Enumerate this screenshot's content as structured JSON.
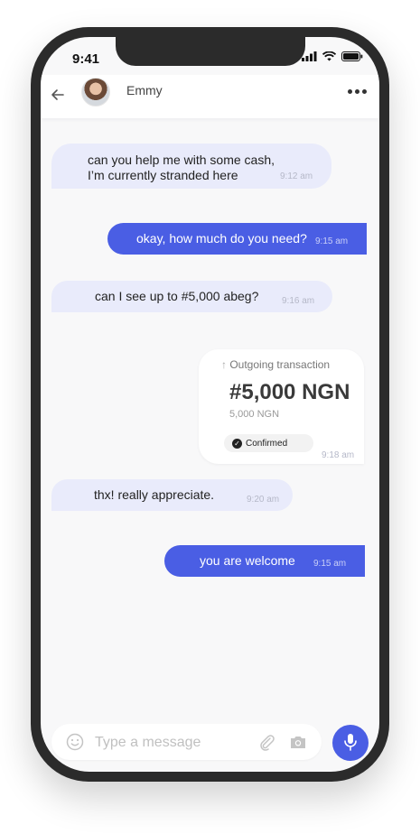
{
  "status_bar": {
    "time": "9:41"
  },
  "header": {
    "contact_name": "Emmy"
  },
  "messages": [
    {
      "direction": "in",
      "line1": "can you help me with some cash,",
      "line2": "I’m currently stranded here",
      "time": "9:12 am"
    },
    {
      "direction": "out",
      "text": "okay, how much do you need?",
      "time": "9:15 am"
    },
    {
      "direction": "in",
      "text": "can I see up to #5,000 abeg?",
      "time": "9:16 am"
    },
    {
      "direction": "in",
      "text": "thx! really appreciate.",
      "time": "9:20 am"
    },
    {
      "direction": "out",
      "text": "you are welcome",
      "time": "9:15 am"
    }
  ],
  "transaction": {
    "label": "Outgoing transaction",
    "amount": "#5,000 NGN",
    "sub_amount": "5,000 NGN",
    "status": "Confirmed",
    "time": "9:18 am"
  },
  "composer": {
    "placeholder": "Type a message",
    "value": ""
  },
  "colors": {
    "accent": "#4a5ee4",
    "incoming": "#e9ebfb",
    "background": "#f8f8f9"
  },
  "icons": [
    "back-arrow-icon",
    "more-icon",
    "emoji-icon",
    "attachment-icon",
    "camera-icon",
    "microphone-icon",
    "signal-icon",
    "wifi-icon",
    "battery-icon"
  ]
}
